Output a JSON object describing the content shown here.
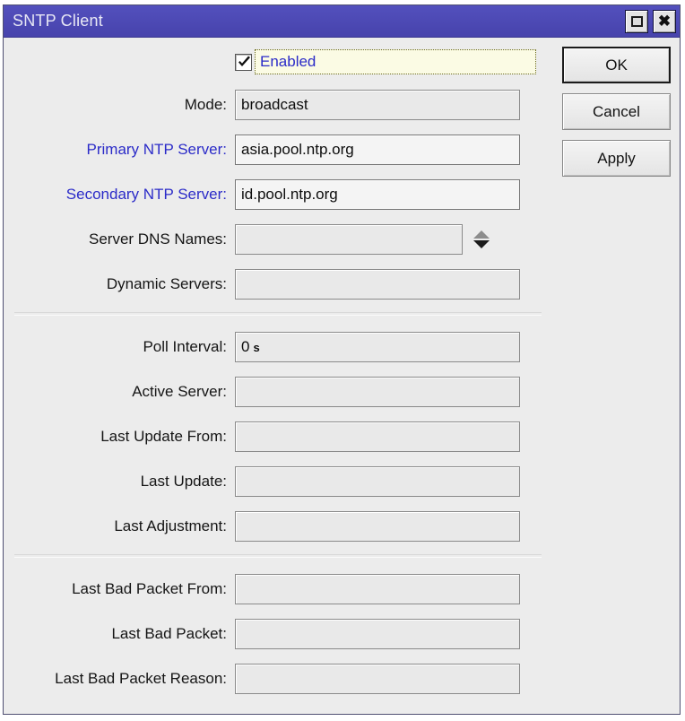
{
  "window": {
    "title": "SNTP Client",
    "controls": [
      {
        "name": "maximize",
        "glyph": "maximize-icon"
      },
      {
        "name": "close",
        "glyph": "✖"
      }
    ]
  },
  "buttons": {
    "ok": "OK",
    "cancel": "Cancel",
    "apply": "Apply"
  },
  "enabled": {
    "label": "Enabled",
    "checked": true
  },
  "fields": {
    "mode": {
      "label": "Mode:",
      "value": "broadcast"
    },
    "primary_ntp": {
      "label": "Primary NTP Server:",
      "value": "asia.pool.ntp.org"
    },
    "secondary_ntp": {
      "label": "Secondary NTP Server:",
      "value": "id.pool.ntp.org"
    },
    "server_dns_names": {
      "label": "Server DNS Names:",
      "value": ""
    },
    "dynamic_servers": {
      "label": "Dynamic Servers:",
      "value": ""
    },
    "poll_interval": {
      "label": "Poll Interval:",
      "value": "0",
      "unit": "s"
    },
    "active_server": {
      "label": "Active Server:",
      "value": ""
    },
    "last_update_from": {
      "label": "Last Update From:",
      "value": ""
    },
    "last_update": {
      "label": "Last Update:",
      "value": ""
    },
    "last_adjustment": {
      "label": "Last Adjustment:",
      "value": ""
    },
    "last_bad_packet_from": {
      "label": "Last Bad Packet From:",
      "value": ""
    },
    "last_bad_packet": {
      "label": "Last Bad Packet:",
      "value": ""
    },
    "last_bad_packet_reason": {
      "label": "Last Bad Packet Reason:",
      "value": ""
    }
  },
  "colors": {
    "titlebar": "#4a47b4",
    "modified_label": "#2b2bc8",
    "body": "#ececec",
    "focus_fill": "#fbfbe4"
  }
}
